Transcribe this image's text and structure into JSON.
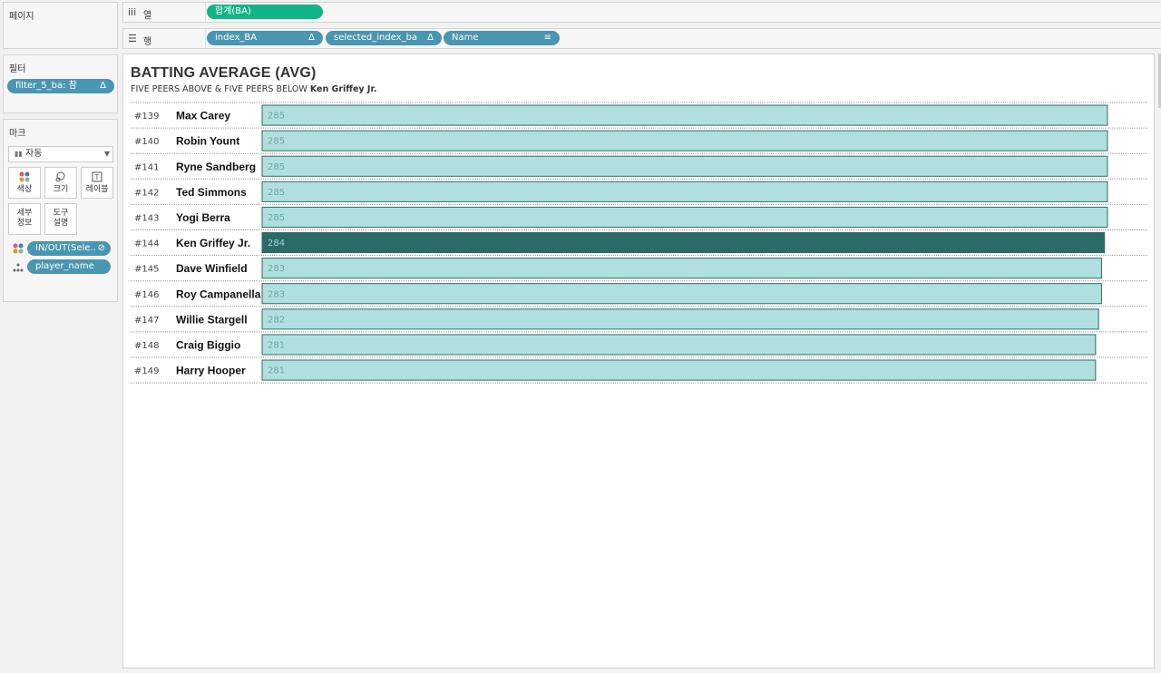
{
  "sidebar": {
    "pages_title": "페이지",
    "filters_title": "필터",
    "filter_pill": "filter_5_ba: 참",
    "filter_pill_icon": "Δ",
    "marks_title": "마크",
    "mark_type": "자동",
    "mark_buttons": {
      "color": "색상",
      "size": "크기",
      "label": "레이블",
      "detail_l1": "세부",
      "detail_l2": "정보",
      "tooltip_l1": "도구",
      "tooltip_l2": "설명"
    },
    "mark_fields": {
      "color_field": "IN/OUT(Sele..",
      "detail_field": "player_name"
    }
  },
  "shelves": {
    "columns_label": "열",
    "columns_pill": "합계(BA)",
    "rows_label": "행",
    "rows_pills": [
      "index_BA",
      "selected_index_ba",
      "Name"
    ],
    "rows_pill_icons": [
      "Δ",
      "Δ",
      "≡"
    ]
  },
  "view": {
    "title": "BATTING AVERAGE (AVG)",
    "subtitle_prefix": "FIVE PEERS ABOVE & FIVE PEERS BELOW ",
    "subtitle_player": "Ken Griffey Jr."
  },
  "colors": {
    "bar_default": "#b0e0de",
    "bar_default_stroke": "#2e6b66",
    "bar_selected": "#2a6b66",
    "label_default": "#6aaaa6",
    "label_selected": "#9fd6d1",
    "pill_blue": "#4996b2",
    "pill_green": "#13b388"
  },
  "chart_data": {
    "type": "bar",
    "orientation": "horizontal",
    "title": "BATTING AVERAGE (AVG)",
    "selected": "Ken Griffey Jr.",
    "rows": [
      {
        "index": "#139",
        "name": "Max Carey",
        "value": 285,
        "selected": false
      },
      {
        "index": "#140",
        "name": "Robin Yount",
        "value": 285,
        "selected": false
      },
      {
        "index": "#141",
        "name": "Ryne Sandberg",
        "value": 285,
        "selected": false
      },
      {
        "index": "#142",
        "name": "Ted Simmons",
        "value": 285,
        "selected": false
      },
      {
        "index": "#143",
        "name": "Yogi Berra",
        "value": 285,
        "selected": false
      },
      {
        "index": "#144",
        "name": "Ken Griffey Jr.",
        "value": 284,
        "selected": true
      },
      {
        "index": "#145",
        "name": "Dave Winfield",
        "value": 283,
        "selected": false
      },
      {
        "index": "#146",
        "name": "Roy Campanella",
        "value": 283,
        "selected": false
      },
      {
        "index": "#147",
        "name": "Willie Stargell",
        "value": 282,
        "selected": false
      },
      {
        "index": "#148",
        "name": "Craig Biggio",
        "value": 281,
        "selected": false
      },
      {
        "index": "#149",
        "name": "Harry Hooper",
        "value": 281,
        "selected": false
      }
    ]
  }
}
